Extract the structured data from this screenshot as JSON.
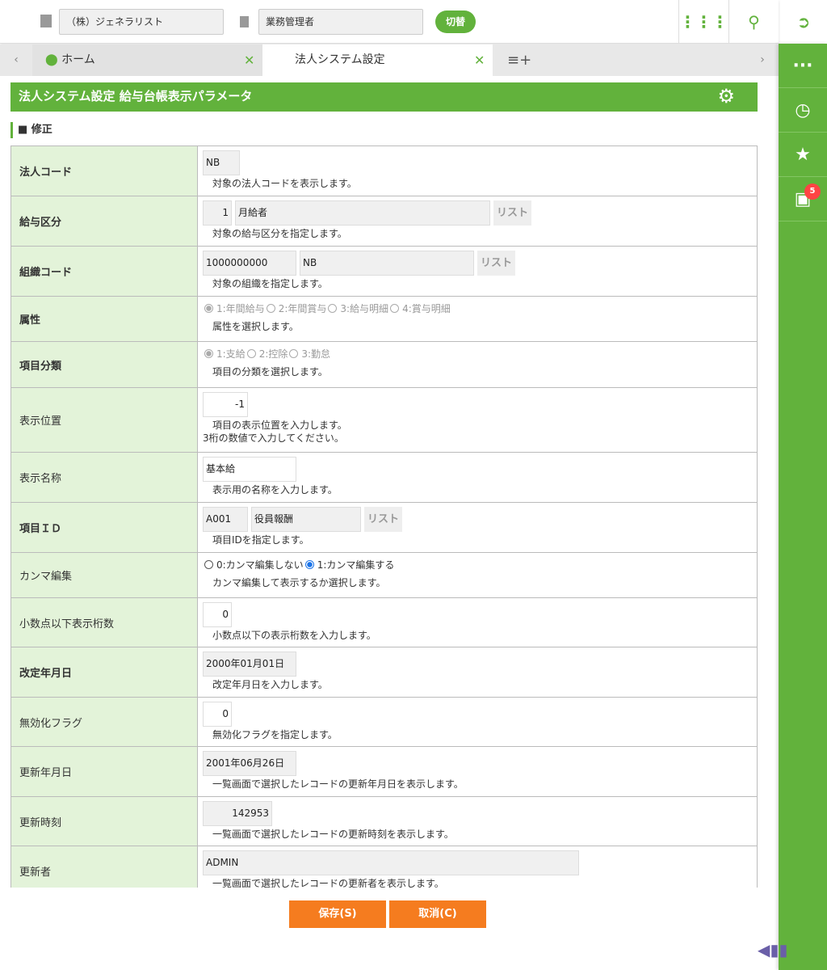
{
  "topbar": {
    "company": "（株）ジェネラリスト",
    "role": "業務管理者",
    "switch_label": "切替",
    "icons": [
      "building-icon",
      "clipboard-icon",
      "apps-grid-icon",
      "search-icon",
      "logout-icon"
    ]
  },
  "tabs": [
    {
      "label": "ホーム"
    },
    {
      "label": "法人システム設定"
    }
  ],
  "page_title": "法人システム設定 給与台帳表示パラメータ",
  "section_title": "■ 修正",
  "sidebar": {
    "badge_count": "5",
    "icons": [
      "more-icon",
      "history-icon",
      "star-icon",
      "inbox-icon"
    ]
  },
  "list_label": "リスト",
  "rows": [
    {
      "label": "法人コード",
      "bold": true,
      "fields": [
        {
          "value": "NB",
          "ro": true
        }
      ],
      "desc": "対象の法人コードを表示します。"
    },
    {
      "label": "給与区分",
      "bold": true,
      "fields": [
        {
          "value": "1",
          "ro": true,
          "right": true
        },
        {
          "value": "月給者",
          "ro": true
        }
      ],
      "list": true,
      "desc": "対象の給与区分を指定します。"
    },
    {
      "label": "組織コード",
      "bold": true,
      "fields": [
        {
          "value": "1000000000",
          "ro": true
        },
        {
          "value": "NB",
          "ro": true
        }
      ],
      "list": true,
      "desc": "対象の組織を指定します。"
    },
    {
      "label": "属性",
      "bold": true,
      "radios": {
        "enabled": false,
        "options": [
          "1:年間給与",
          "2:年間賞与",
          "3:給与明細",
          "4:賞与明細"
        ],
        "selected": 0
      },
      "desc": "属性を選択します。"
    },
    {
      "label": "項目分類",
      "bold": true,
      "radios": {
        "enabled": false,
        "options": [
          "1:支給",
          "2:控除",
          "3:勤怠"
        ],
        "selected": 0
      },
      "desc": "項目の分類を選択します。"
    },
    {
      "label": "表示位置",
      "bold": false,
      "fields": [
        {
          "value": "-1",
          "ro": false,
          "right": true
        }
      ],
      "desc": "項目の表示位置を入力します。",
      "note": "3桁の数値で入力してください。"
    },
    {
      "label": "表示名称",
      "bold": false,
      "fields": [
        {
          "value": "基本給",
          "ro": false
        }
      ],
      "desc": "表示用の名称を入力します。"
    },
    {
      "label": "項目ＩＤ",
      "bold": true,
      "fields": [
        {
          "value": "A001",
          "ro": true
        },
        {
          "value": "役員報酬",
          "ro": true
        }
      ],
      "list": true,
      "desc": "項目IDを指定します。"
    },
    {
      "label": "カンマ編集",
      "bold": false,
      "radios": {
        "enabled": true,
        "options": [
          "0:カンマ編集しない",
          "1:カンマ編集する"
        ],
        "selected": 1
      },
      "desc": "カンマ編集して表示するか選択します。"
    },
    {
      "label": "小数点以下表示桁数",
      "bold": false,
      "fields": [
        {
          "value": "0",
          "ro": false,
          "right": true
        }
      ],
      "desc": "小数点以下の表示桁数を入力します。"
    },
    {
      "label": "改定年月日",
      "bold": true,
      "fields": [
        {
          "value": "2000年01月01日",
          "ro": true
        }
      ],
      "desc": "改定年月日を入力します。"
    },
    {
      "label": "無効化フラグ",
      "bold": false,
      "fields": [
        {
          "value": "0",
          "ro": false,
          "right": true
        }
      ],
      "desc": "無効化フラグを指定します。"
    },
    {
      "label": "更新年月日",
      "bold": false,
      "fields": [
        {
          "value": "2001年06月26日",
          "ro": true
        }
      ],
      "desc": "一覧画面で選択したレコードの更新年月日を表示します。"
    },
    {
      "label": "更新時刻",
      "bold": false,
      "fields": [
        {
          "value": "142953",
          "ro": true,
          "right": true
        }
      ],
      "desc": "一覧画面で選択したレコードの更新時刻を表示します。"
    },
    {
      "label": "更新者",
      "bold": false,
      "fields": [
        {
          "value": "ADMIN",
          "ro": true
        }
      ],
      "desc": "一覧画面で選択したレコードの更新者を表示します。"
    }
  ],
  "buttons": {
    "save": "保存(S)",
    "cancel": "取消(C)"
  }
}
